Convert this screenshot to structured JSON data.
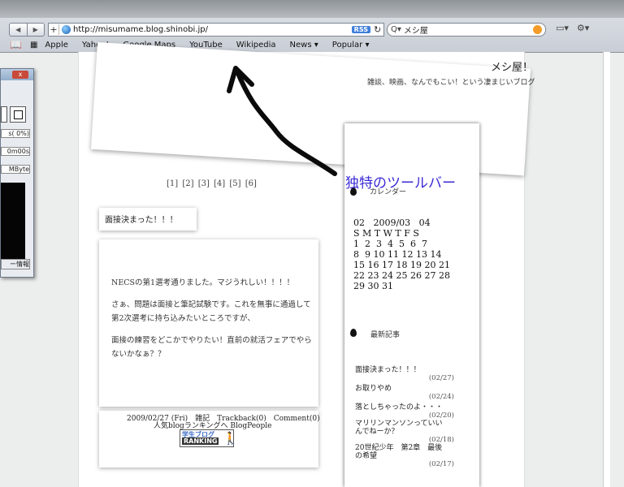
{
  "browser": {
    "url": "http://misumame.blog.shinobi.jp/",
    "rss_label": "RSS",
    "search_text": "メシ屋",
    "bookmarks": [
      "Apple",
      "Yahoo!",
      "Google Maps",
      "YouTube",
      "Wikipedia",
      "News ▾",
      "Popular ▾"
    ],
    "left_window": {
      "percent": "s( 0%)",
      "time": "0m00s",
      "size": "MByte",
      "info": "ー情報"
    }
  },
  "blog": {
    "title": "メシ屋！",
    "subtitle": "雑談、映画、なんでもこい！という凄まじいブログ",
    "pager": "[1] [2] [3] [4] [5] [6]"
  },
  "post": {
    "title": "面接決まった！！！",
    "body": [
      "NECSの第1選考通りました。マジうれしい！！！！",
      "さぁ、問題は面接と筆記試験です。これを無事に通過して第2次選考に持ち込みたいところですが、",
      "面接の練習をどこかでやりたい！直前の就活フェアでやらないかなぁ？？"
    ],
    "meta": "2009/02/27 (Fri)　雑記　Trackback(0)　Comment(0)",
    "links": "人気blogランキングへ BlogPeople",
    "badge_top": "学生ブログ",
    "badge_bottom": "RANKING"
  },
  "sidebar": {
    "calendar_heading": "カレンダー",
    "calendar_lines": [
      "02   2009/03   04",
      "S M T W T F S",
      "1  2  3  4  5  6  7",
      "8  9 10 11 12 13 14",
      "15 16 17 18 19 20 21",
      "22 23 24 25 26 27 28",
      "29 30 31"
    ],
    "recent_heading": "最新記事",
    "recent": [
      {
        "title": "面接決まった！！！",
        "date": "(02/27)"
      },
      {
        "title": "お取りやめ",
        "date": "(02/24)"
      },
      {
        "title": "落としちゃったのよ・・・",
        "date": "(02/20)"
      },
      {
        "title": "マリリンマンソンっていいんでねーか？",
        "date": "(02/18)"
      },
      {
        "title": "20世紀少年　第2章　最後の希望",
        "date": "(02/17)"
      }
    ]
  },
  "annotation": {
    "label": "独特のツールバー"
  }
}
